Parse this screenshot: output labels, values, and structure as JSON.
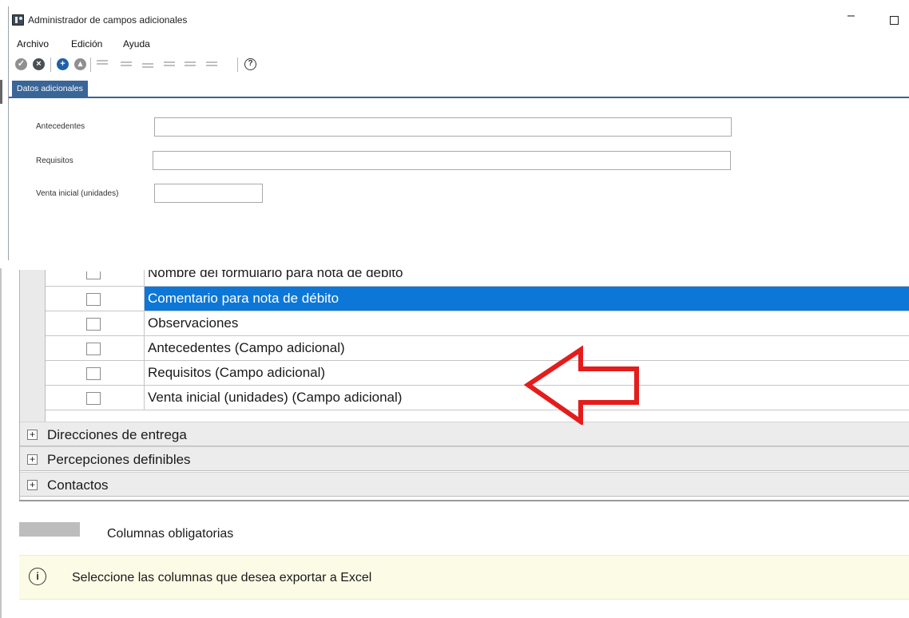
{
  "window": {
    "title": "Administrador de campos adicionales"
  },
  "menu": {
    "items": [
      "Archivo",
      "Edición",
      "Ayuda"
    ]
  },
  "toolbar": {
    "icons": [
      "check-icon",
      "close-icon",
      "add-icon",
      "up-icon",
      "align-top-icon",
      "align-middle-icon",
      "align-bottom-icon",
      "align-left-icon",
      "align-center-icon",
      "align-right-icon",
      "help-icon"
    ],
    "add_glyph": "+",
    "help_glyph": "?"
  },
  "tabs": {
    "active": "Datos adicionales"
  },
  "form": {
    "fields": [
      {
        "label": "Antecedentes",
        "value": ""
      },
      {
        "label": "Requisitos",
        "value": ""
      },
      {
        "label": "Venta inicial (unidades)",
        "value": ""
      }
    ]
  },
  "grid": {
    "rows": [
      {
        "label": "Nombre del formulario para nota de débito",
        "checked": false,
        "selected": false
      },
      {
        "label": "Comentario para nota de débito",
        "checked": false,
        "selected": true
      },
      {
        "label": "Observaciones",
        "checked": false,
        "selected": false
      },
      {
        "label": "Antecedentes (Campo adicional)",
        "checked": false,
        "selected": false
      },
      {
        "label": "Requisitos (Campo adicional)",
        "checked": false,
        "selected": false
      },
      {
        "label": "Venta inicial (unidades) (Campo adicional)",
        "checked": false,
        "selected": false
      }
    ],
    "groups": [
      {
        "label": "Direcciones de entrega",
        "expand_glyph": "+"
      },
      {
        "label": "Percepciones definibles",
        "expand_glyph": "+"
      },
      {
        "label": "Contactos",
        "expand_glyph": "+"
      }
    ]
  },
  "legend": {
    "label": "Columnas obligatorias",
    "swatch_color": "#bdbdbd"
  },
  "info": {
    "icon_glyph": "i",
    "text": "Seleccione las columnas que desea exportar a Excel"
  },
  "annotation": {
    "arrow_color": "#e41c1c"
  },
  "colors": {
    "selection": "#0c77d7",
    "tab": "#3a6597"
  }
}
